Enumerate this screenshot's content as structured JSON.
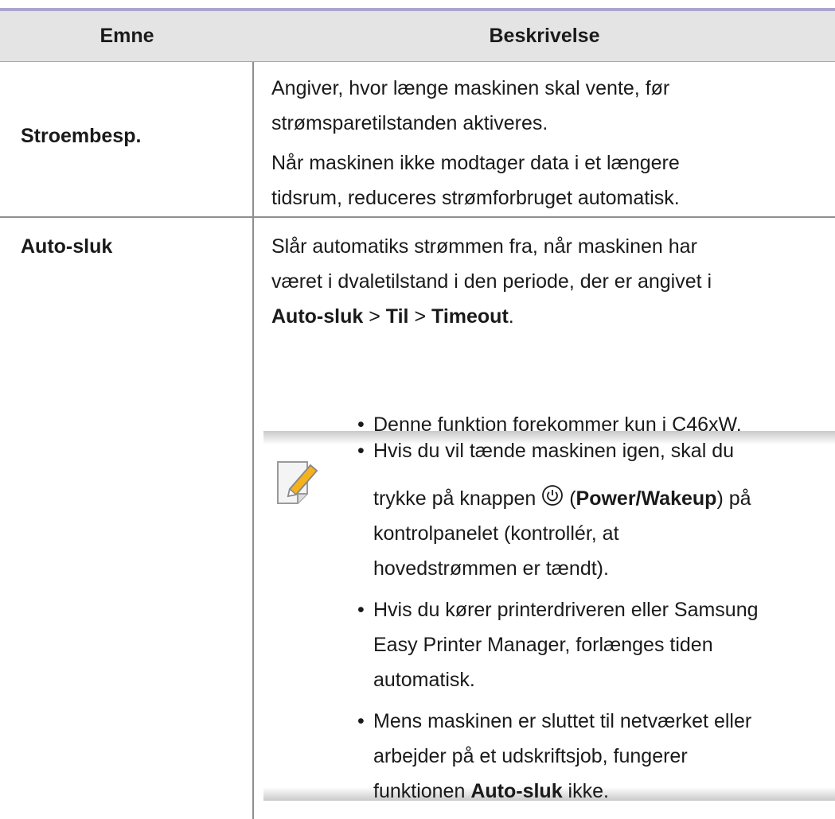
{
  "table": {
    "headers": {
      "topic": "Emne",
      "description": "Beskrivelse"
    },
    "rows": [
      {
        "topic": "Stroembesp.",
        "lines": [
          "Angiver, hvor længe maskinen skal vente, før",
          "strømsparetilstanden aktiveres.",
          "Når maskinen ikke modtager data i et længere",
          "tidsrum, reduceres strømforbruget automatisk."
        ]
      },
      {
        "topic": "Auto-sluk",
        "lines": [
          "Slår automatiks strømmen fra, når maskinen har",
          "været i dvaletilstand i den periode, der er angivet i"
        ],
        "path": {
          "a": "Auto-sluk",
          "sep1": " > ",
          "b": "Til",
          "sep2": " > ",
          "c": "Timeout",
          "end": "."
        }
      }
    ]
  },
  "note": {
    "icon": "note-pencil-icon",
    "bullet": "•",
    "items": {
      "i1": "Denne funktion forekommer kun i C46xW.",
      "i2_l1": "Hvis du vil tænde maskinen igen, skal du",
      "i2_l2_pre": "trykke på knappen ",
      "i2_open": " (",
      "i2_bold": "Power/Wakeup",
      "i2_close": ") på",
      "i2_l3": "kontrolpanelet (kontrollér, at",
      "i2_l4": "hovedstrømmen er tændt).",
      "i3_l1": "Hvis du kører printerdriveren eller Samsung",
      "i3_l2": "Easy Printer Manager, forlænges tiden",
      "i3_l3": "automatisk.",
      "i4_l1": "Mens maskinen er sluttet til netværket eller",
      "i4_l2": "arbejder på et udskriftsjob, fungerer",
      "i4_l3_pre": "funktionen ",
      "i4_bold": "Auto-sluk",
      "i4_l3_post": " ikke."
    }
  }
}
